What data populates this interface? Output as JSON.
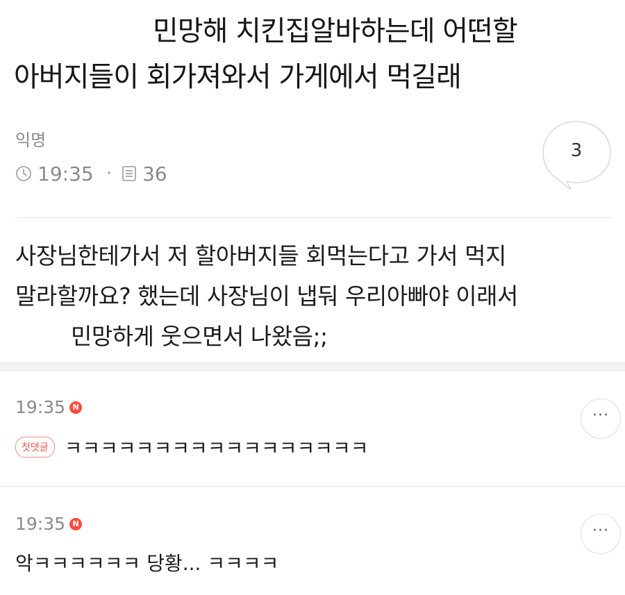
{
  "post": {
    "title_line1": "민망해 치킨집알바하는데 어떤할",
    "title_line2": "아버지들이 회가져와서 가게에서 먹길래",
    "author": "익명",
    "time": "19:35",
    "views": "36",
    "comment_count": "3",
    "body_line1": "사장님한테가서 저 할아버지들 회먹는다고 가서 먹지",
    "body_line2": "말라할까요? 했는데 사장님이 냅둬 우리아빠야 이래서",
    "body_line3": "민망하게    웃으면서 나왔음;;"
  },
  "comments": [
    {
      "time": "19:35",
      "badge": "N",
      "tag": "첫댓글",
      "text": "ㅋㅋㅋㅋㅋㅋㅋㅋㅋㅋㅋㅋㅋㅋㅋㅋㅋ",
      "more": "···"
    },
    {
      "time": "19:35",
      "badge": "N",
      "text": "악ㅋㅋㅋㅋㅋㅋ 당황... ㅋㅋㅋㅋ",
      "more": "···"
    }
  ],
  "icons": {
    "time": "clock-icon",
    "views": "document-icon",
    "comments": "speech-bubble-icon",
    "more": "more-options-icon"
  },
  "colors": {
    "new_badge": "#ff4a3d",
    "first_tag": "#e8564d",
    "meta_text": "#8a8a8a"
  }
}
